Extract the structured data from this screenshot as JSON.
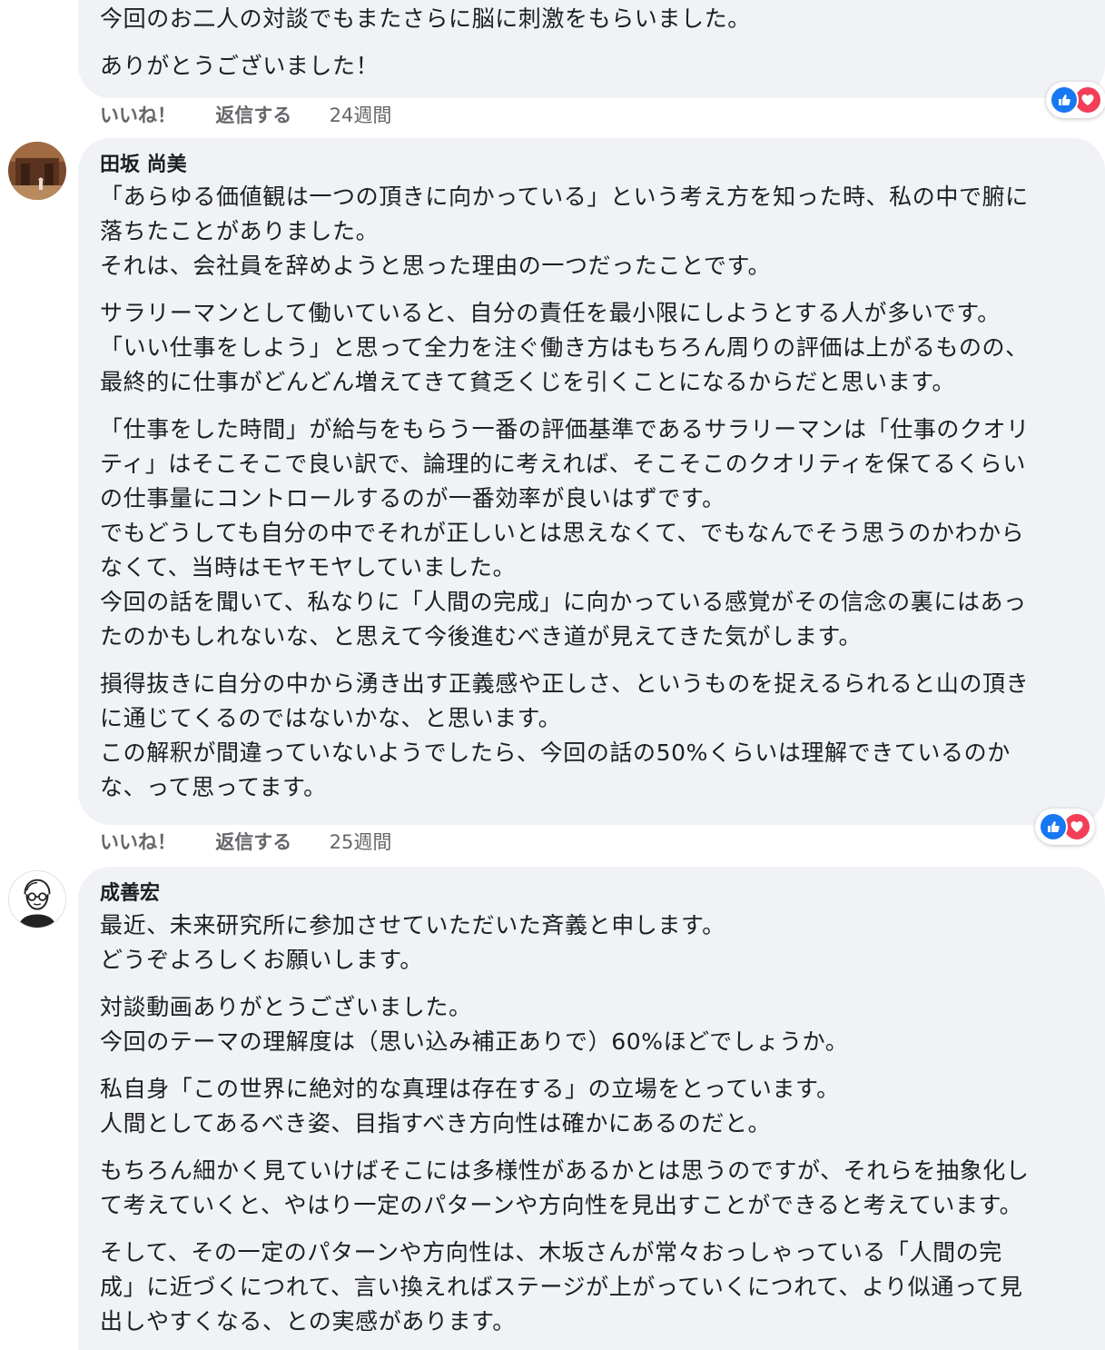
{
  "comment_prev": {
    "paragraphs": [
      "今回のお二人の対談でもまたさらに脳に刺激をもらいました。",
      "ありがとうございました！"
    ],
    "actions": {
      "like": "いいね！",
      "reply": "返信する",
      "time": "24週間"
    },
    "reactions": [
      "like",
      "love"
    ]
  },
  "comment_tasaka": {
    "author": "田坂 尚美",
    "paragraphs": [
      "「あらゆる価値観は一つの頂きに向かっている」という考え方を知った時、私の中で腑に\n落ちたことがありました。\nそれは、会社員を辞めようと思った理由の一つだったことです。",
      "サラリーマンとして働いていると、自分の責任を最小限にしようとする人が多いです。\n「いい仕事をしよう」と思って全力を注ぐ働き方はもちろん周りの評価は上がるものの、\n最終的に仕事がどんどん増えてきて貧乏くじを引くことになるからだと思います。",
      "「仕事をした時間」が給与をもらう一番の評価基準であるサラリーマンは「仕事のクオリ\nティ」はそこそこで良い訳で、論理的に考えれば、そこそこのクオリティを保てるくらい\nの仕事量にコントロールするのが一番効率が良いはずです。\nでもどうしても自分の中でそれが正しいとは思えなくて、でもなんでそう思うのかわから\nなくて、当時はモヤモヤしていました。\n今回の話を聞いて、私なりに「人間の完成」に向かっている感覚がその信念の裏にはあっ\nたのかもしれないな、と思えて今後進むべき道が見えてきた気がします。",
      "損得抜きに自分の中から湧き出す正義感や正しさ、というものを捉えるられると山の頂き\nに通じてくるのではないかな、と思います。\nこの解釈が間違っていないようでしたら、今回の話の50%くらいは理解できているのか\nな、って思ってます。"
    ],
    "actions": {
      "like": "いいね！",
      "reply": "返信する",
      "time": "25週間"
    },
    "reactions": [
      "like",
      "love"
    ]
  },
  "comment_sei": {
    "author": "成善宏",
    "paragraphs": [
      "最近、未来研究所に参加させていただいた斉義と申します。\nどうぞよろしくお願いします。",
      "対談動画ありがとうございました。\n今回のテーマの理解度は（思い込み補正ありで）60%ほどでしょうか。",
      "私自身「この世界に絶対的な真理は存在する」の立場をとっています。\n人間としてあるべき姿、目指すべき方向性は確かにあるのだと。",
      "もちろん細かく見ていけばそこには多様性があるかとは思うのですが、それらを抽象化し\nて考えていくと、やはり一定のパターンや方向性を見出すことができると考えています。",
      "そして、その一定のパターンや方向性は、木坂さんが常々おっしゃっている「人間の完\n成」に近づくにつれて、言い換えればステージが上がっていくにつれて、より似通って見\n出しやすくなる、との実感があります。"
    ]
  }
}
